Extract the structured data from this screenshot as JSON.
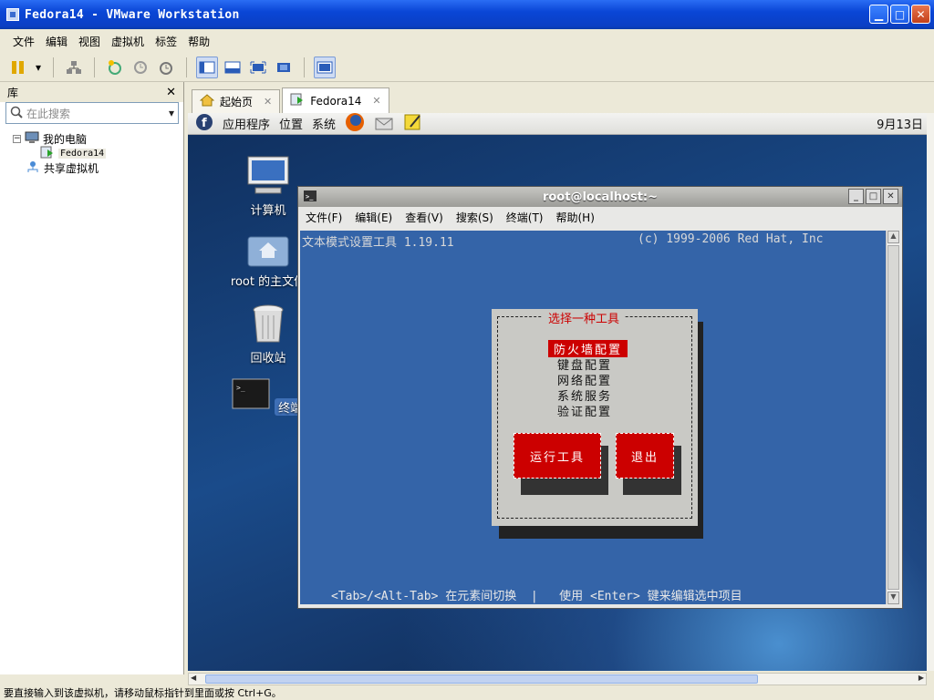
{
  "window": {
    "title": "Fedora14 - VMware Workstation"
  },
  "menubar": [
    "文件",
    "编辑",
    "视图",
    "虚拟机",
    "标签",
    "帮助"
  ],
  "library": {
    "title": "库",
    "search_placeholder": "在此搜索",
    "tree": {
      "my_computer": "我的电脑",
      "vm": "Fedora14",
      "shared": "共享虚拟机"
    }
  },
  "tabs": [
    {
      "label": "起始页"
    },
    {
      "label": "Fedora14"
    }
  ],
  "guest": {
    "panel": {
      "apps": "应用程序",
      "places": "位置",
      "system": "系统",
      "clock": "9月13日"
    },
    "desktop_icons": [
      {
        "label": "计算机",
        "icon": "computer-icon"
      },
      {
        "label": "root 的主文件",
        "icon": "home-folder-icon"
      },
      {
        "label": "回收站",
        "icon": "trash-icon"
      },
      {
        "label": "终端",
        "icon": "terminal-icon"
      }
    ],
    "terminal": {
      "title": "root@localhost:~",
      "menu": [
        "文件(F)",
        "编辑(E)",
        "查看(V)",
        "搜索(S)",
        "终端(T)",
        "帮助(H)"
      ],
      "header_left": "文本模式设置工具 1.19.11",
      "header_right": "(c) 1999-2006 Red Hat, Inc",
      "dialog": {
        "title": "选择一种工具",
        "items": [
          "防火墙配置",
          "键盘配置",
          "网络配置",
          "系统服务",
          "验证配置"
        ],
        "selected_index": 0,
        "run_button": "运行工具",
        "quit_button": "退出"
      },
      "footer": "<Tab>/<Alt-Tab> 在元素间切换  |   使用 <Enter> 键来编辑选中项目"
    }
  },
  "status": "要直接输入到该虚拟机，请移动鼠标指针到里面或按 Ctrl+G。"
}
